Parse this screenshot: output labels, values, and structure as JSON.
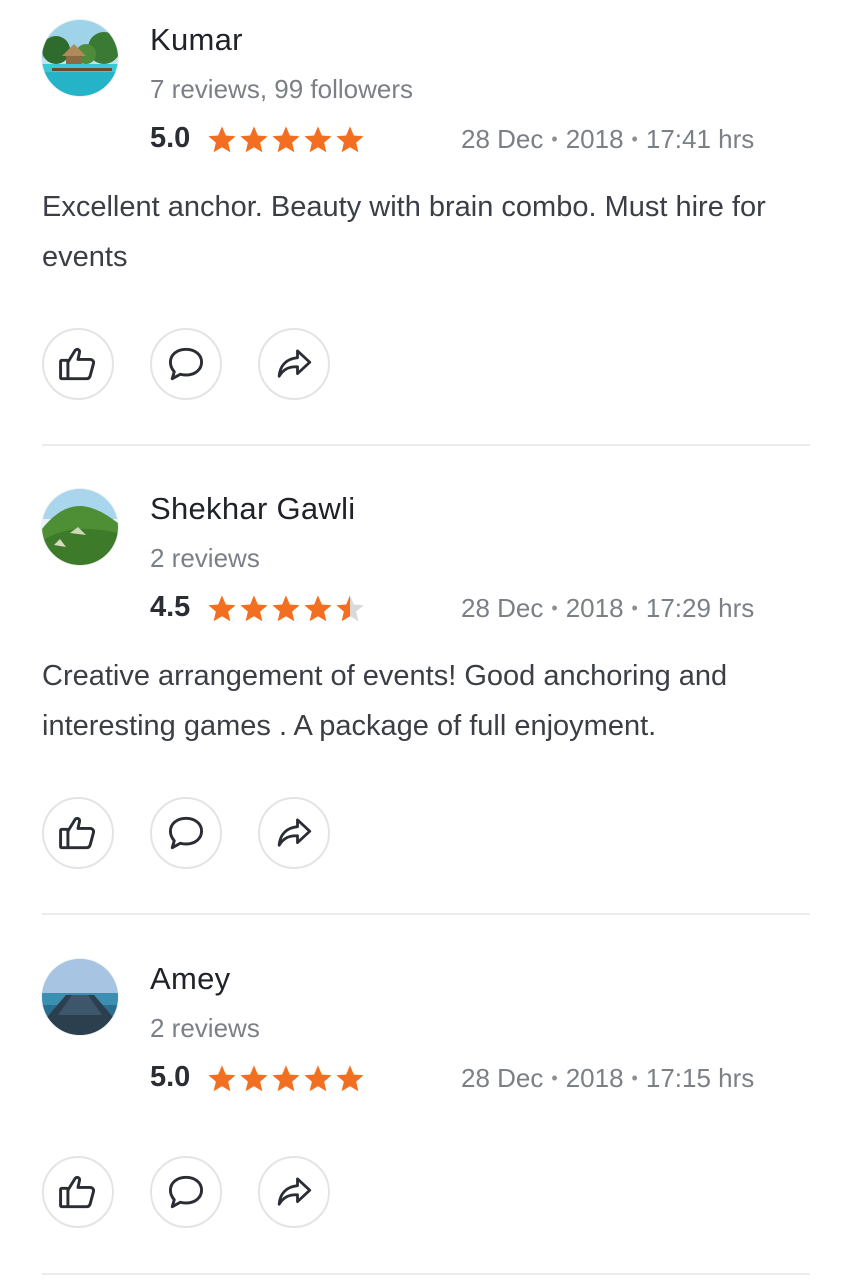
{
  "colors": {
    "star": "#f26f21",
    "star_empty": "#d9d9d9",
    "text": "#3b3f45",
    "muted": "#7b8087",
    "divider": "#ececec"
  },
  "reviews": [
    {
      "name": "Kumar",
      "meta": "7 reviews, 99 followers",
      "rating": "5.0",
      "rating_value": 5.0,
      "date": "28 Dec",
      "year": "2018",
      "time": "17:41 hrs",
      "text": "Excellent anchor. Beauty with brain combo. Must hire for events",
      "avatar_icon": "beach-resort-photo"
    },
    {
      "name": "Shekhar Gawli",
      "meta": "2 reviews",
      "rating": "4.5",
      "rating_value": 4.5,
      "date": "28 Dec",
      "year": "2018",
      "time": "17:29 hrs",
      "text": "Creative arrangement of events! Good anchoring and interesting games . A package of full enjoyment.",
      "avatar_icon": "green-hill-photo"
    },
    {
      "name": "Amey",
      "meta": "2 reviews",
      "rating": "5.0",
      "rating_value": 5.0,
      "date": "28 Dec",
      "year": "2018",
      "time": "17:15 hrs",
      "text": "",
      "avatar_icon": "ocean-pier-photo"
    }
  ],
  "actions": [
    "thumbs-up-icon",
    "comment-icon",
    "share-icon"
  ]
}
